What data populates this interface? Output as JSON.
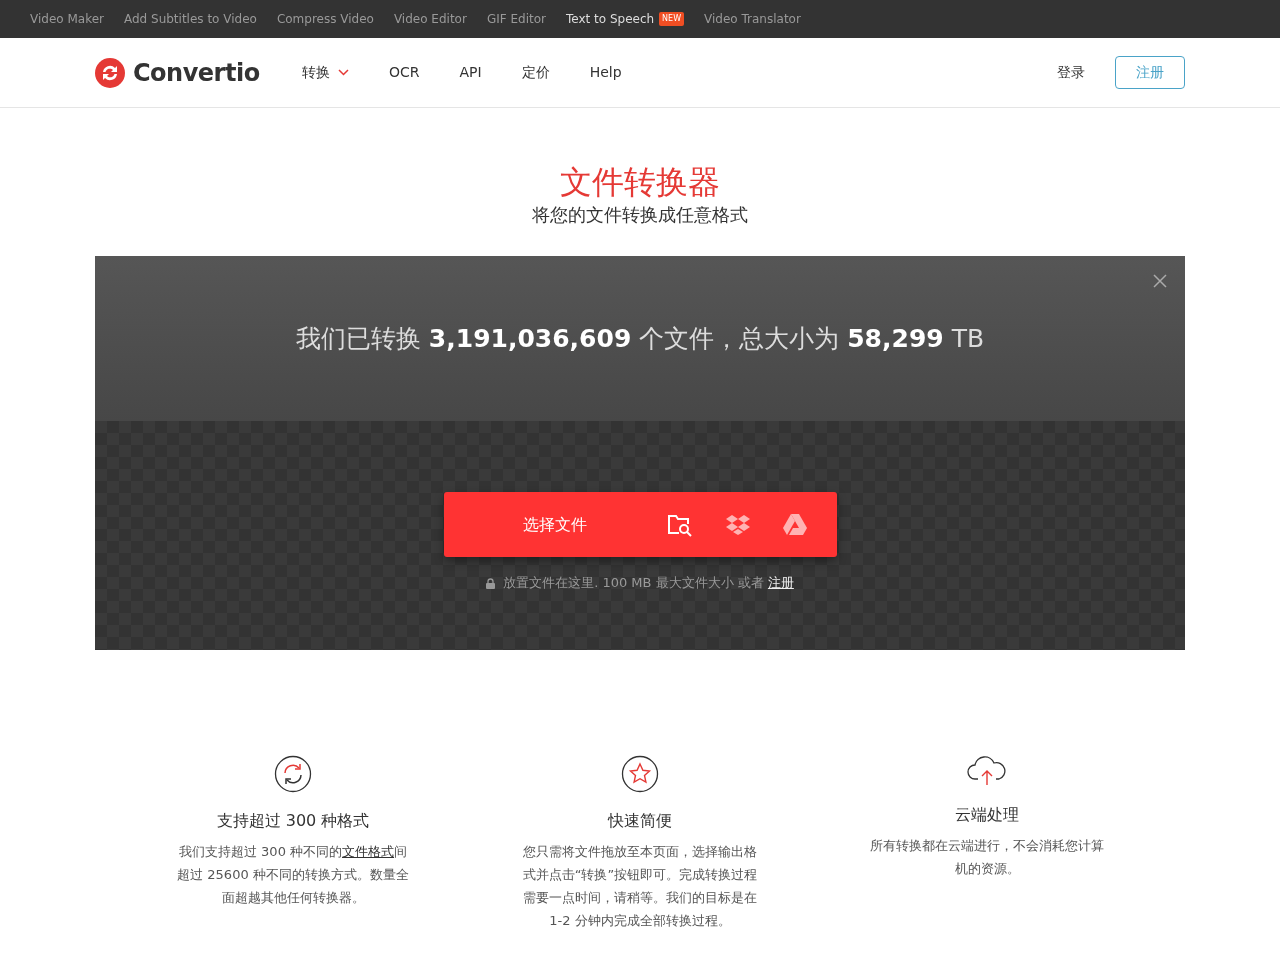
{
  "top_links": [
    {
      "label": "Video Maker",
      "highlighted": false
    },
    {
      "label": "Add Subtitles to Video",
      "highlighted": false
    },
    {
      "label": "Compress Video",
      "highlighted": false
    },
    {
      "label": "Video Editor",
      "highlighted": false
    },
    {
      "label": "GIF Editor",
      "highlighted": false
    },
    {
      "label": "Text to Speech",
      "highlighted": true,
      "badge": "NEW"
    },
    {
      "label": "Video Translator",
      "highlighted": false
    }
  ],
  "navbar": {
    "logo": "Convertio",
    "menu": [
      {
        "label": "转换",
        "dropdown": true
      },
      {
        "label": "OCR",
        "dropdown": false
      },
      {
        "label": "API",
        "dropdown": false
      },
      {
        "label": "定价",
        "dropdown": false
      },
      {
        "label": "Help",
        "dropdown": false
      }
    ],
    "login": "登录",
    "signup": "注册"
  },
  "hero": {
    "title": "文件转换器",
    "subtitle": "将您的文件转换成任意格式"
  },
  "stats": {
    "text": "我们已转换 **3,191,036,609** 个文件，总大小为 **58,299** TB"
  },
  "upload": {
    "button": "选择文件",
    "hint": "放置文件在这里. 100 MB 最大文件大小 或者",
    "hint_link": "注册"
  },
  "features": [
    {
      "title": "支持超过 300 种格式",
      "text_before": "我们支持超过 300 种不同的",
      "link": "文件格式",
      "text_after": "间超过 25600 种不同的转换方式。数量全面超越其他任何转换器。"
    },
    {
      "title": "快速简便",
      "text_before": "您只需将文件拖放至本页面，选择输出格式并点击“转换”按钮即可。完成转换过程需要一点时间，请稍等。我们的目标是在 1-2 分钟内完成全部转换过程。"
    },
    {
      "title": "云端处理",
      "text_before": "所有转换都在云端进行，不会消耗您计算机的资源。"
    }
  ]
}
